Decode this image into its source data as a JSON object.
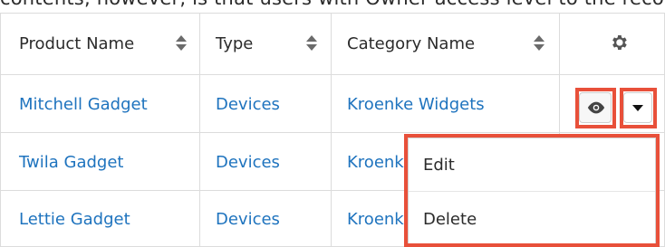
{
  "top_text_fragment": "contents, however, is that users with Owner access level to the record",
  "table": {
    "headers": [
      {
        "label": "Product Name"
      },
      {
        "label": "Type"
      },
      {
        "label": "Category Name"
      }
    ],
    "rows": [
      [
        "Mitchell Gadget",
        "Devices",
        "Kroenke Widgets"
      ],
      [
        "Twila Gadget",
        "Devices",
        "Kroenk"
      ],
      [
        "Lettie Gadget",
        "Devices",
        "Kroenk"
      ]
    ]
  },
  "actions_menu": {
    "items": [
      "Edit",
      "Delete"
    ]
  },
  "colors": {
    "link_blue": "#1e73be",
    "highlight_red": "#e8503a",
    "border_gray": "#dcdcdc",
    "header_text": "#2b2b2b"
  },
  "icons": [
    "sort-icon",
    "gear-icon",
    "eye-icon",
    "caret-down-icon"
  ]
}
